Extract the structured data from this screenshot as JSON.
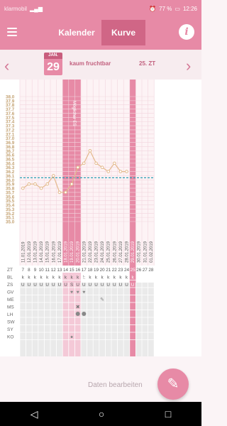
{
  "status": {
    "carrier": "klarmobil",
    "battery": "77 %",
    "time": "12:26"
  },
  "header": {
    "tab_calendar": "Kalender",
    "tab_curve": "Kurve",
    "info": "i"
  },
  "date_row": {
    "month": "JAN.",
    "day": "29",
    "fertility": "kaum fruchtbar",
    "cycle_day": "25. ZT",
    "prev": "‹",
    "next": "›"
  },
  "colors": {
    "accent": "#e78aa6",
    "dark_accent": "#c85d7d",
    "line": "#e3b98c",
    "coverline": "#2a9fb3"
  },
  "chart_data": {
    "type": "line",
    "y_ticks": [
      "38.0",
      "37.9",
      "37.8",
      "37.7",
      "37.6",
      "37.5",
      "37.4",
      "37.3",
      "37.2",
      "37.1",
      "37.0",
      "36.9",
      "36.8",
      "36.7",
      "36.6",
      "36.5",
      "36.4",
      "36.3",
      "36.2",
      "36.1",
      "36.0",
      "35.9",
      "35.8",
      "35.7",
      "35.6",
      "35.5",
      "35.4",
      "35.3",
      "35.2",
      "35.1",
      "35.0"
    ],
    "ylim": [
      35.0,
      38.0
    ],
    "dates": [
      "11.01.2019",
      "12.01.2019",
      "13.01.2019",
      "14.01.2019",
      "15.01.2019",
      "16.01.2019",
      "17.01.2019",
      "18.01.2019",
      "19.01.2019",
      "20.01.2019",
      "21.01.2019",
      "22.01.2019",
      "23.01.2019",
      "24.01.2019",
      "25.01.2019",
      "26.01.2019",
      "27.01.2019",
      "28.01.2019",
      "29.01.2019",
      "30.01.2019",
      "31.01.2019",
      "01.02.2019"
    ],
    "zt": [
      "7",
      "8",
      "9",
      "10",
      "11",
      "12",
      "13",
      "14",
      "15",
      "16",
      "17",
      "18",
      "19",
      "20",
      "21",
      "22",
      "23",
      "24",
      "25",
      "26",
      "27",
      "28"
    ],
    "series": [
      {
        "values": [
          35.8,
          35.9,
          35.9,
          35.8,
          35.9,
          36.1,
          35.7,
          35.7,
          35.9,
          36.3,
          36.4,
          36.7,
          36.4,
          36.3,
          36.2,
          36.4,
          36.2,
          36.2,
          null,
          null,
          null,
          null
        ]
      }
    ],
    "coverline": 36.05,
    "ovulation_label": "Möglicher ES",
    "row_labels": [
      "ZT",
      "BL",
      "ZS",
      "GV",
      "ME",
      "MS",
      "LH",
      "SW",
      "SY",
      "KO"
    ],
    "bl": [
      "k",
      "k",
      "k",
      "k",
      "k",
      "k",
      "k",
      "k",
      "k",
      "k",
      "k",
      "k",
      "k",
      "k",
      "k",
      "k",
      "k",
      "k",
      "k",
      "",
      "",
      ""
    ],
    "zs": [
      "U",
      "U",
      "U",
      "U",
      "U",
      "U",
      "U",
      "U",
      "S",
      "U",
      "U",
      "U",
      "U",
      "U",
      "U",
      "U",
      "U",
      "U",
      "U",
      "",
      "",
      ""
    ]
  },
  "footer": {
    "edit_link": "Daten bearbeiten",
    "fab": "✎"
  },
  "navbar": {
    "back": "◁",
    "home": "○",
    "recent": "□"
  }
}
